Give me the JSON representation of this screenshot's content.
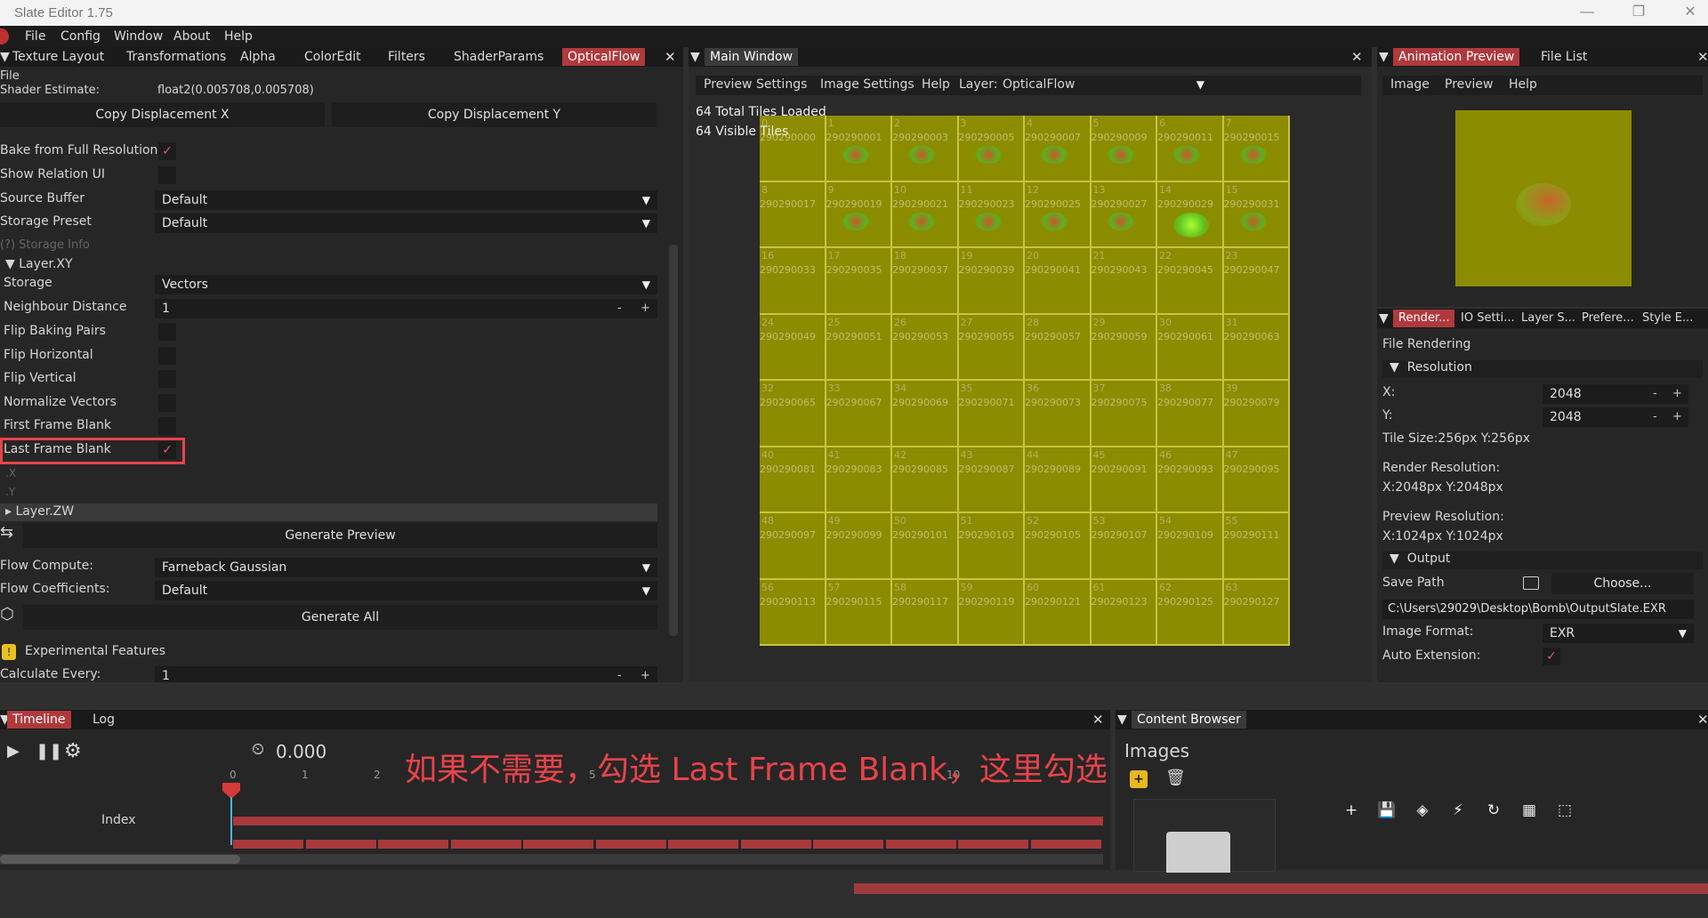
{
  "window": {
    "title": "Slate Editor 1.75",
    "minimize": "—",
    "maximize": "❐",
    "close": "✕"
  },
  "menu": [
    "File",
    "Config",
    "Window",
    "About",
    "Help"
  ],
  "left_tabs": [
    "Texture Layout",
    "Transformations",
    "Alpha",
    "ColorEdit",
    "Filters",
    "ShaderParams",
    "OpticalFlow"
  ],
  "left": {
    "file_label": "File",
    "shader_estimate_label": "Shader Estimate:",
    "shader_estimate_value": "float2(0.005708,0.005708)",
    "copy_x": "Copy Displacement X",
    "copy_y": "Copy Displacement Y",
    "bake_full": "Bake from Full Resolution",
    "show_relation": "Show Relation UI",
    "source_buffer": "Source Buffer",
    "source_buffer_value": "Default",
    "storage_preset": "Storage Preset",
    "storage_preset_value": "Default",
    "storage_info": "(?) Storage Info",
    "layer_xy": "Layer.XY",
    "storage": "Storage",
    "storage_value": "Vectors",
    "neighbour_distance": "Neighbour Distance",
    "neighbour_value": "1",
    "flip_baking": "Flip Baking Pairs",
    "flip_horizontal": "Flip Horizontal",
    "flip_vertical": "Flip Vertical",
    "normalize": "Normalize Vectors",
    "first_blank": "First Frame Blank",
    "last_blank": "Last Frame Blank",
    "x_label": ".X",
    "y_label": ".Y",
    "layer_zw": "Layer.ZW",
    "generate_preview": "Generate Preview",
    "flow_compute": "Flow Compute:",
    "flow_compute_value": "Farneback Gaussian",
    "flow_coeff": "Flow Coefficients:",
    "flow_coeff_value": "Default",
    "generate_all": "Generate All",
    "experimental": "Experimental Features",
    "calc_every": "Calculate Every:",
    "calc_value": "1",
    "minus": "-",
    "plus": "+",
    "check": "✓"
  },
  "main": {
    "tab": "Main Window",
    "toolbar": [
      "Preview Settings",
      "Image Settings",
      "Help"
    ],
    "layer_label": "Layer:",
    "layer_value": "OpticalFlow",
    "tiles_loaded": "64 Total Tiles Loaded",
    "tiles_visible": "64 Visible Tiles",
    "tile_bg": "#8c8c00",
    "tile_ids": [
      "290290000",
      "290290001",
      "290290003",
      "290290005",
      "290290007",
      "290290009",
      "290290011",
      "290290015",
      "290290017",
      "290290019",
      "290290021",
      "290290023",
      "290290025",
      "290290027",
      "290290029",
      "290290031",
      "290290033",
      "290290035",
      "290290037",
      "290290039",
      "290290041",
      "290290043",
      "290290045",
      "290290047",
      "290290049",
      "290290051",
      "290290053",
      "290290055",
      "290290057",
      "290290059",
      "290290061",
      "290290063",
      "290290065",
      "290290067",
      "290290069",
      "290290071",
      "290290073",
      "290290075",
      "290290077",
      "290290079",
      "290290081",
      "290290083",
      "290290085",
      "290290087",
      "290290089",
      "290290091",
      "290290093",
      "290290095",
      "290290097",
      "290290099",
      "290290101",
      "290290103",
      "290290105",
      "290290107",
      "290290109",
      "290290111",
      "290290113",
      "290290115",
      "290290117",
      "290290119",
      "290290121",
      "290290123",
      "290290125",
      "290290127"
    ]
  },
  "anim": {
    "tabs": [
      "Animation Preview",
      "File List"
    ],
    "toolbar": [
      "Image",
      "Preview",
      "Help"
    ],
    "preview_bg": "#8c8c00"
  },
  "render": {
    "tabs": [
      "Render...",
      "IO Setti...",
      "Layer S...",
      "Prefere...",
      "Style E..."
    ],
    "file_rendering": "File Rendering",
    "resolution": "Resolution",
    "x_label": "X:",
    "x_value": "2048",
    "y_label": "Y:",
    "y_value": "2048",
    "tile_size": "Tile Size:256px  Y:256px",
    "render_res_label": "Render Resolution:",
    "render_res_value": "X:2048px  Y:2048px",
    "preview_res_label": "Preview Resolution:",
    "preview_res_value": "X:1024px  Y:1024px",
    "output": "Output",
    "save_path": "Save Path",
    "choose": "Choose...",
    "path_value": "C:\\Users\\29029\\Desktop\\Bomb\\OutputSlate.EXR",
    "image_format": "Image Format:",
    "image_format_value": "EXR",
    "auto_ext": "Auto Extension:"
  },
  "timeline": {
    "tabs": [
      "Timeline",
      "Log"
    ],
    "time": "0.000",
    "ticks": [
      "0",
      "1",
      "2",
      "5",
      "10"
    ],
    "index_label": "Index",
    "annotation": "如果不需要，勾选 Last Frame Blank，这里勾选"
  },
  "content": {
    "tab": "Content Browser",
    "images": "Images"
  },
  "colors": {
    "accent": "#b0393d",
    "highlight_box": "#e8434a",
    "annotation": "#e8434a"
  }
}
